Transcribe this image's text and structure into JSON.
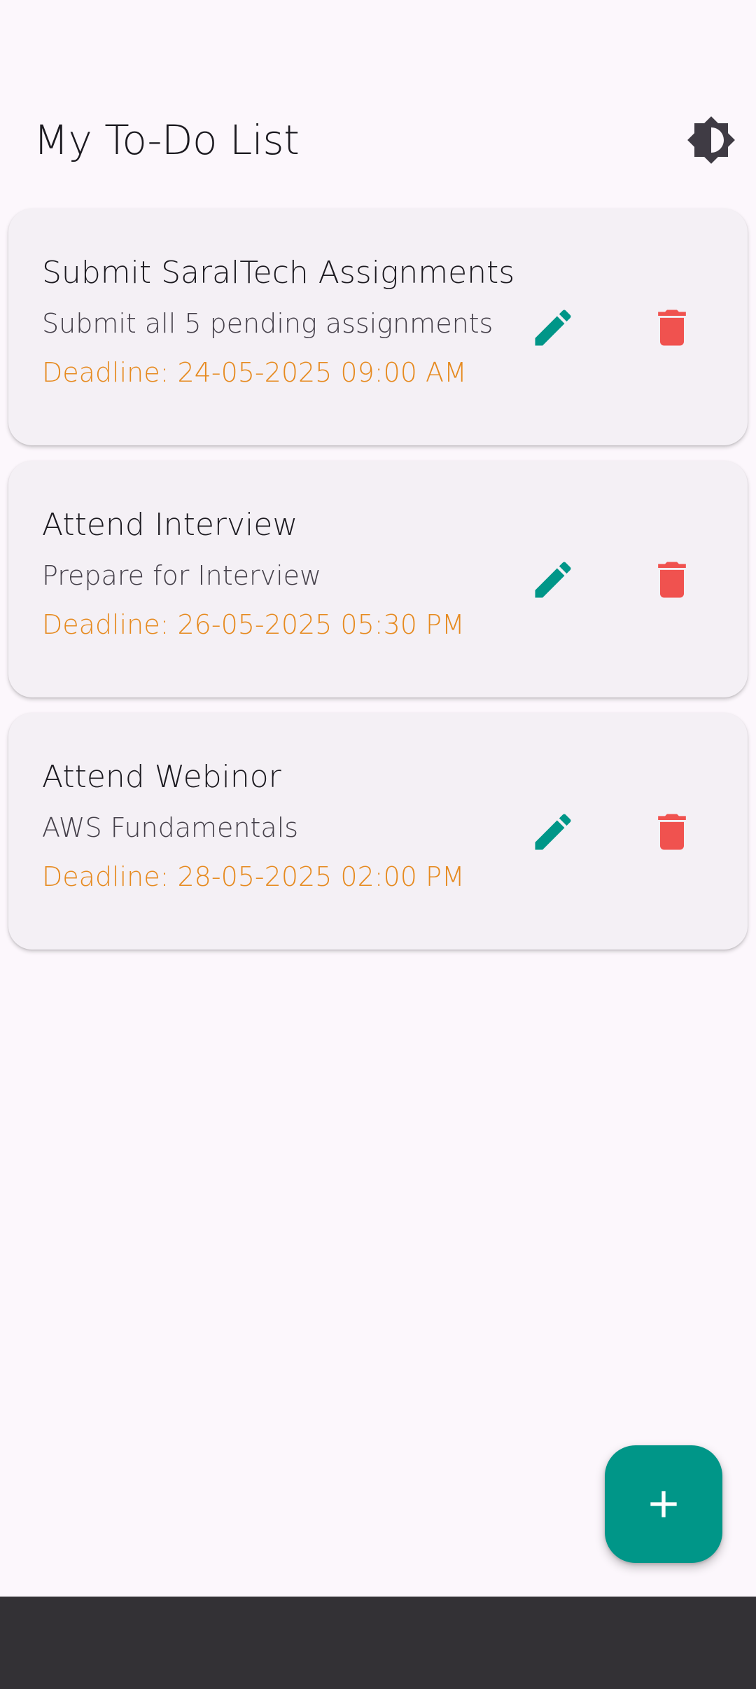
{
  "header": {
    "title": "My To-Do List",
    "theme_icon": "brightness-contrast-icon"
  },
  "colors": {
    "background": "#fcf7fc",
    "card_background": "#f4f0f5",
    "accent": "#009688",
    "delete": "#f0524f",
    "deadline": "#e68a1f",
    "nav_bar": "#333135"
  },
  "tasks": [
    {
      "title": "Submit SaralTech Assignments",
      "description": "Submit all 5 pending assignments",
      "deadline": "Deadline: 24-05-2025 09:00 AM"
    },
    {
      "title": "Attend Interview",
      "description": "Prepare for Interview",
      "deadline": "Deadline: 26-05-2025 05:30 PM"
    },
    {
      "title": "Attend Webinor",
      "description": "AWS Fundamentals",
      "deadline": "Deadline: 28-05-2025 02:00 PM"
    }
  ],
  "fab": {
    "icon": "plus-icon"
  }
}
